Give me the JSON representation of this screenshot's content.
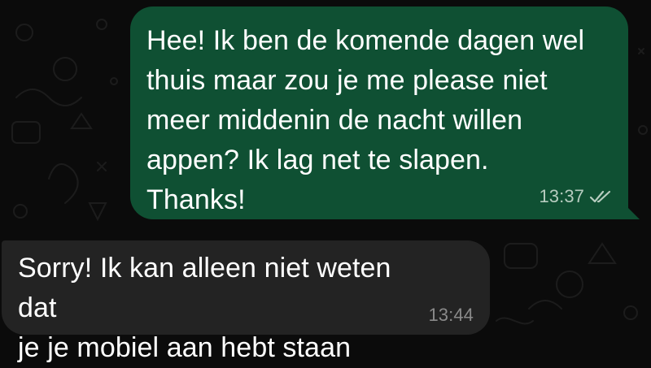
{
  "messages": [
    {
      "direction": "outgoing",
      "text": "Hee! Ik ben de komende dagen wel\nthuis maar zou je me please niet\nmeer middenin de nacht willen\nappen? Ik lag net te slapen.\nThanks!",
      "time": "13:37",
      "status_icon": "double-check-icon"
    },
    {
      "direction": "incoming",
      "text": "Sorry! Ik kan alleen niet weten dat\nje je mobiel aan hebt staan",
      "time": "13:44"
    }
  ],
  "colors": {
    "background": "#0b0b0b",
    "outgoing_bubble": "#0f5033",
    "incoming_bubble": "#232323",
    "text": "#ffffff"
  }
}
